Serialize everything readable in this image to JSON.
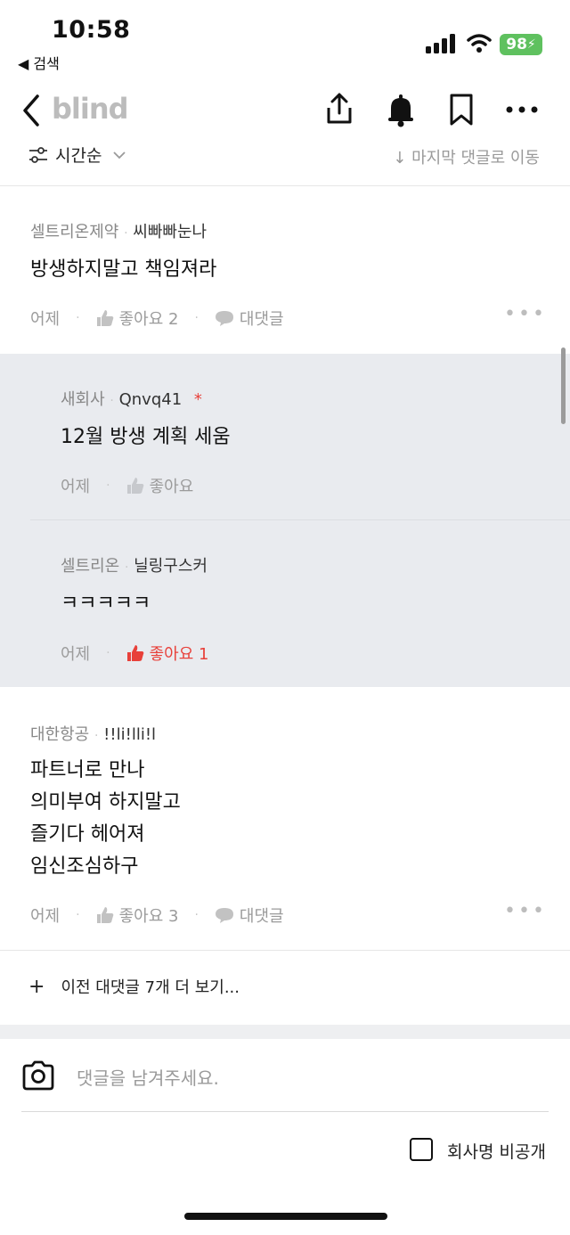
{
  "status": {
    "time": "10:58",
    "back_app": "◀ 검색",
    "battery": "98"
  },
  "nav": {
    "logo": "blind"
  },
  "sort": {
    "label": "시간순",
    "jump": "↓ 마지막 댓글로 이동"
  },
  "comments": [
    {
      "company": "셀트리온제약",
      "nick": "씨빠빠눈나",
      "text": "방생하지말고 책임져라",
      "time": "어제",
      "like": "좋아요 2",
      "reply": "대댓글"
    },
    {
      "company": "대한항공",
      "nick": "!!li!lli!l",
      "lines": [
        "파트너로 만나",
        "의미부여 하지말고",
        "즐기다 헤어져",
        "임신조심하구"
      ],
      "time": "어제",
      "like": "좋아요 3",
      "reply": "대댓글"
    }
  ],
  "replies": [
    {
      "company": "새회사",
      "nick": "Qnvq41",
      "author_mark": "*",
      "text": "12월 방생 계획 세움",
      "time": "어제",
      "like": "좋아요"
    },
    {
      "company": "셀트리온",
      "nick": "닐링구스커",
      "text": "ㅋㅋㅋㅋㅋ",
      "time": "어제",
      "like": "좋아요 1"
    }
  ],
  "more_comments": "이전 대댓글 7개 더 보기...",
  "input": {
    "placeholder": "댓글을 남겨주세요.",
    "anon_label": "회사명 비공개"
  },
  "colors": {
    "accent_red": "#e8403a",
    "reply_bg": "#e9ebef",
    "battery_green": "#5fc15f"
  }
}
